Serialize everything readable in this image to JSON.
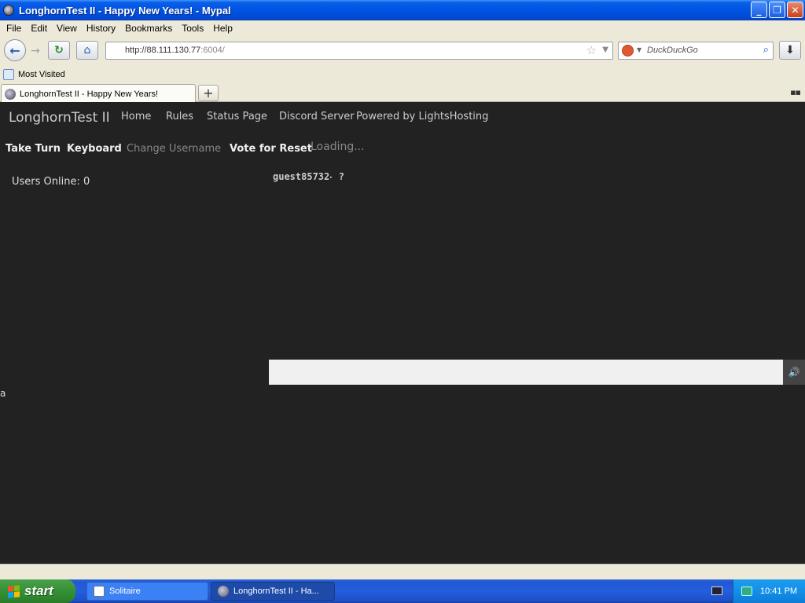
{
  "window": {
    "title": "LonghornTest II - Happy New Years! - Mypal",
    "minimize": "_",
    "restore": "❐",
    "close": "✕"
  },
  "menu": [
    "File",
    "Edit",
    "View",
    "History",
    "Bookmarks",
    "Tools",
    "Help"
  ],
  "toolbar": {
    "url_host": "http://88.111.130.77",
    "url_port": ":6004/",
    "search_placeholder": "DuckDuckGo",
    "back_icon": "←",
    "forward_icon": "→",
    "reload_icon": "↻",
    "home_icon": "⌂",
    "star_icon": "☆",
    "dropdown_icon": "▼",
    "search_icon": "⌕",
    "download_icon": "⬇"
  },
  "bookmarks": {
    "most_visited": "Most Visited"
  },
  "tabs": {
    "active_label": "LonghornTest II - Happy New Years!",
    "new_tab": "+",
    "tablist": "▪▪"
  },
  "site": {
    "brand": "LonghornTest II",
    "nav": [
      "Home",
      "Rules",
      "Status Page",
      "Discord Server",
      "Powered by LightsHosting"
    ],
    "actions": {
      "take_turn": "Take Turn",
      "keyboard": "Keyboard",
      "change_username": "Change Username",
      "vote_reset": "Vote for Reset"
    },
    "loading": "Loading...",
    "users_online": "Users Online: 0",
    "guest_name": "guest85732",
    "guest_arrow": "▸",
    "guest_suffix": "?",
    "sound_icon": "🔊",
    "stray_text": "a"
  },
  "taskbar": {
    "start": "start",
    "items": [
      "Solitaire",
      "LonghornTest II - Ha..."
    ],
    "clock": "10:41 PM"
  },
  "colors": {
    "content_bg": "#222222",
    "taskbar_blue": "#245edc",
    "start_green": "#3a923a"
  }
}
